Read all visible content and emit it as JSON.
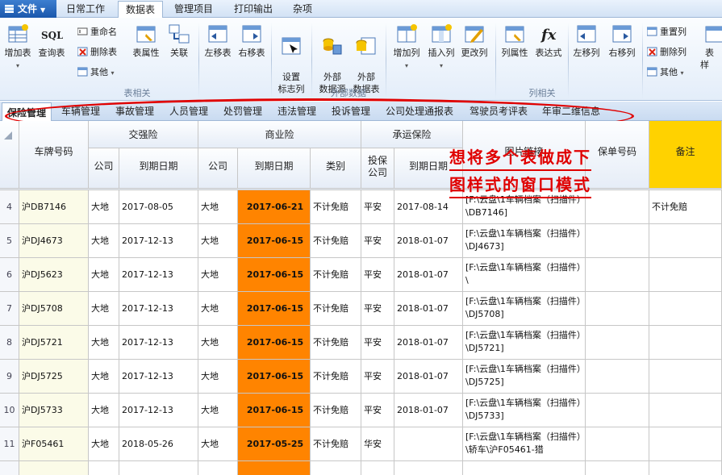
{
  "menubar": {
    "file_label": "文件",
    "tabs": [
      "日常工作",
      "数据表",
      "管理项目",
      "打印输出",
      "杂项"
    ],
    "active_tab": "数据表"
  },
  "ribbon": {
    "groups": {
      "table": "表相关",
      "external": "外部数据",
      "column": "列相关"
    },
    "buttons": {
      "add_table": "增加表",
      "query_table": "查询表",
      "rename": "重命名",
      "delete_table": "删除表",
      "other1": "其他",
      "table_props": "表属性",
      "relation": "关联",
      "move_table_left": "左移表",
      "move_table_right": "右移表",
      "set_flag_col": "设置\n标志列",
      "ext_source": "外部\n数据源",
      "ext_table": "外部\n数据表",
      "add_col": "增加列",
      "insert_col": "插入列",
      "change_col": "更改列",
      "col_props": "列属性",
      "expression": "表达式",
      "move_col_left": "左移列",
      "move_col_right": "右移列",
      "reset_col": "重置列",
      "delete_col": "删除列",
      "other2": "其他",
      "table_tail": "表样"
    }
  },
  "subtabs": [
    "保险管理",
    "车辆管理",
    "事故管理",
    "人员管理",
    "处罚管理",
    "违法管理",
    "投诉管理",
    "公司处理通报表",
    "驾驶员考评表",
    "年审二维信息"
  ],
  "active_subtab": "保险管理",
  "overlay_note": [
    "想将多个表做成下",
    "图样式的窗口模式"
  ],
  "table": {
    "group_headers": {
      "plate": "车牌号码",
      "jqx": "交强险",
      "syx": "商业险",
      "cyx": "承运保险",
      "img": "图片链接",
      "policy": "保单号码",
      "memo": "备注"
    },
    "sub_headers": [
      "公司",
      "到期日期",
      "公司",
      "到期日期",
      "类别",
      "投保\n公司",
      "到期日期"
    ],
    "rows": [
      {
        "n": "4",
        "plate": "沪DB7146",
        "c1": "大地",
        "d1": "2017-08-05",
        "c2": "大地",
        "d2": "2017-06-21",
        "cat": "不计免赔",
        "c3": "平安",
        "d3": "2017-08-14",
        "img": "[F:\\云盘\\1车辆档案（扫描件）\\DB7146]",
        "policy": "",
        "memo": "不计免赔"
      },
      {
        "n": "5",
        "plate": "沪DJ4673",
        "c1": "大地",
        "d1": "2017-12-13",
        "c2": "大地",
        "d2": "2017-06-15",
        "cat": "不计免赔",
        "c3": "平安",
        "d3": "2018-01-07",
        "img": "[F:\\云盘\\1车辆档案（扫描件）\\DJ4673]",
        "policy": "",
        "memo": ""
      },
      {
        "n": "6",
        "plate": "沪DJ5623",
        "c1": "大地",
        "d1": "2017-12-13",
        "c2": "大地",
        "d2": "2017-06-15",
        "cat": "不计免赔",
        "c3": "平安",
        "d3": "2018-01-07",
        "img": "[F:\\云盘\\1车辆档案（扫描件）\\",
        "policy": "",
        "memo": ""
      },
      {
        "n": "7",
        "plate": "沪DJ5708",
        "c1": "大地",
        "d1": "2017-12-13",
        "c2": "大地",
        "d2": "2017-06-15",
        "cat": "不计免赔",
        "c3": "平安",
        "d3": "2018-01-07",
        "img": "[F:\\云盘\\1车辆档案（扫描件）\\DJ5708]",
        "policy": "",
        "memo": ""
      },
      {
        "n": "8",
        "plate": "沪DJ5721",
        "c1": "大地",
        "d1": "2017-12-13",
        "c2": "大地",
        "d2": "2017-06-15",
        "cat": "不计免赔",
        "c3": "平安",
        "d3": "2018-01-07",
        "img": "[F:\\云盘\\1车辆档案（扫描件）\\DJ5721]",
        "policy": "",
        "memo": ""
      },
      {
        "n": "9",
        "plate": "沪DJ5725",
        "c1": "大地",
        "d1": "2017-12-13",
        "c2": "大地",
        "d2": "2017-06-15",
        "cat": "不计免赔",
        "c3": "平安",
        "d3": "2018-01-07",
        "img": "[F:\\云盘\\1车辆档案（扫描件）\\DJ5725]",
        "policy": "",
        "memo": ""
      },
      {
        "n": "10",
        "plate": "沪DJ5733",
        "c1": "大地",
        "d1": "2017-12-13",
        "c2": "大地",
        "d2": "2017-06-15",
        "cat": "不计免赔",
        "c3": "平安",
        "d3": "2018-01-07",
        "img": "[F:\\云盘\\1车辆档案（扫描件）\\DJ5733]",
        "policy": "",
        "memo": ""
      },
      {
        "n": "11",
        "plate": "沪F05461",
        "c1": "大地",
        "d1": "2018-05-26",
        "c2": "大地",
        "d2": "2017-05-25",
        "cat": "不计免赔",
        "c3": "华安",
        "d3": "",
        "img": "[F:\\云盘\\1车辆档案（扫描件）\\轿车\\沪F05461-猎",
        "policy": "",
        "memo": ""
      }
    ]
  },
  "colors": {
    "highlight_date": "#ff8400",
    "memo_header": "#ffd200",
    "annotation": "#e00000",
    "accent": "#1a57ac"
  }
}
